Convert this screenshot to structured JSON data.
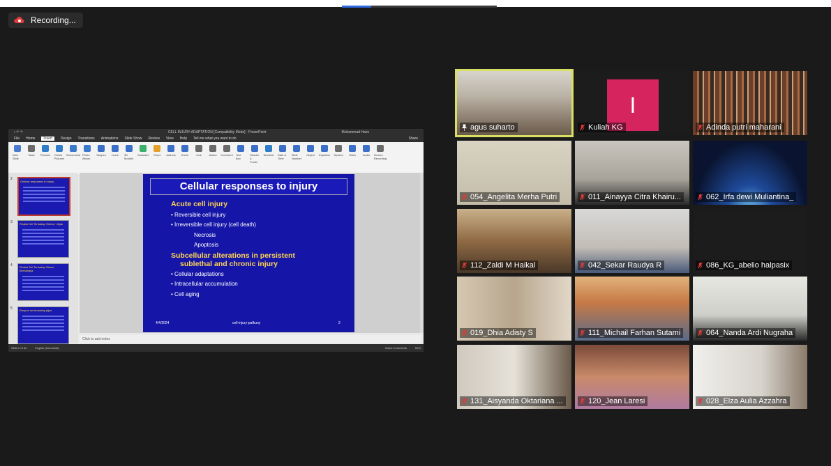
{
  "recording": {
    "label": "Recording..."
  },
  "ppt": {
    "title_text": "CELL INJURY ADAPTATION [Compatibility Mode] - PowerPoint",
    "user_text": "Muhammad Haris",
    "menu": [
      "File",
      "Home",
      "Insert",
      "Design",
      "Transitions",
      "Animations",
      "Slide Show",
      "Review",
      "View",
      "Help",
      "Tell me what you want to do"
    ],
    "share_label": "Share",
    "ribbon_items": [
      "New Slide",
      "Table",
      "Pictures",
      "Online Pictures",
      "Screenshot",
      "Photo Album",
      "Shapes",
      "Icons",
      "3D Models",
      "SmartArt",
      "Chart",
      "Add-ins",
      "Zoom",
      "Link",
      "Action",
      "Comment",
      "Text Box",
      "Header & Footer",
      "WordArt",
      "Date & Time",
      "Slide Number",
      "Object",
      "Equation",
      "Symbol",
      "Video",
      "Audio",
      "Screen Recording"
    ],
    "thumbs": [
      {
        "num": "2",
        "title": "Cellular responses to injury"
      },
      {
        "num": "3",
        "title": "Reaksi Sel Terhadap Stress / Jejas"
      },
      {
        "num": "4",
        "title": "Reaksi Sel Terhadap Stress Berbahaya"
      },
      {
        "num": "5",
        "title": "Respon sel terhadap jejas"
      }
    ],
    "notes_placeholder": "Click to add notes",
    "status_left": "Slide 2 of 32",
    "status_lang": "English (Indonesia)",
    "status_right": "Notes   Comments",
    "zoom": "62%"
  },
  "slide": {
    "title": "Cellular responses to injury",
    "section1": "Acute cell injury",
    "bullets1": [
      "Reversible cell injury",
      "Irreversible cell injury (cell death)"
    ],
    "subs": [
      "Necrosis",
      "Apoptosis"
    ],
    "section2_line1": "Subcellular alterations in persistent",
    "section2_line2": "sublethal and chronic injury",
    "bullets2": [
      "Cellular adaptations",
      "Intracellular accumulation",
      "Cell aging"
    ],
    "footer_date": "4/4/2024",
    "footer_center": "cell-injury-pafkuny",
    "footer_page": "2"
  },
  "participants": [
    {
      "name": "agus suharto",
      "muted": false
    },
    {
      "name": "Kuliah KG",
      "muted": true,
      "initial": "I"
    },
    {
      "name": "Adinda putri maharani",
      "muted": true
    },
    {
      "name": "054_Angelita Merha Putri",
      "muted": true
    },
    {
      "name": "011_Ainayya Citra Khairu...",
      "muted": true
    },
    {
      "name": "062_Irfa dewi Muliantina_",
      "muted": true
    },
    {
      "name": "112_Zaldi M Haikal",
      "muted": true
    },
    {
      "name": "042_Sekar Raudya R",
      "muted": true
    },
    {
      "name": "086_KG_abelio halpasix",
      "muted": true
    },
    {
      "name": "019_Dhia Adisty S",
      "muted": true
    },
    {
      "name": "111_Michail Farhan Sutami",
      "muted": true
    },
    {
      "name": "064_Nanda Ardi Nugraha",
      "muted": true
    },
    {
      "name": "131_Aisyanda Oktariana ...",
      "muted": true
    },
    {
      "name": "120_Jean Laresi",
      "muted": true
    },
    {
      "name": "028_Elza Aulia Azzahra",
      "muted": true
    }
  ],
  "colors": {
    "speaker_border": "#d8e063",
    "slide_bg": "#1515a8",
    "slide_heading": "#ffd54f",
    "recording_icon": "#e03a3a"
  }
}
